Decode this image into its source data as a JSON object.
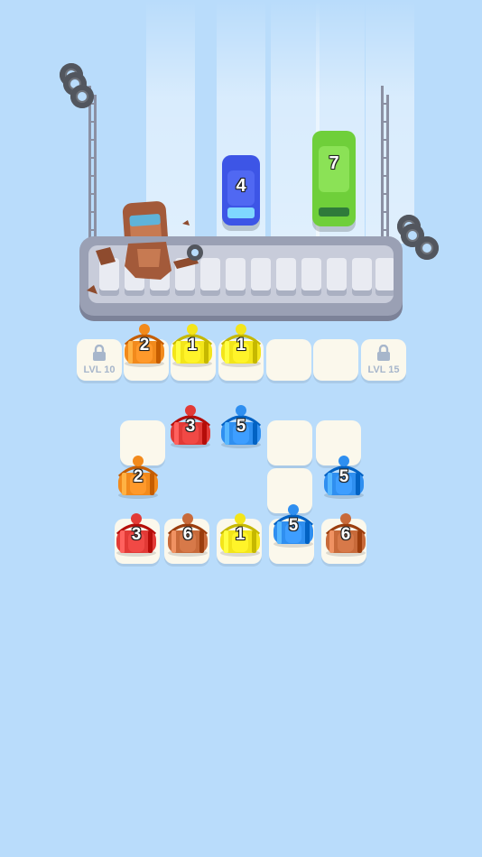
{
  "colors": {
    "background": "#b9dcfb",
    "orange": "#f28a1c",
    "yellow": "#f3e51a",
    "red": "#e23a36",
    "blue": "#2f8ff0",
    "brown": "#c86a3a",
    "car_blue": "#3d55e6",
    "car_green": "#6fcf3a",
    "car_brown": "#a35a3a"
  },
  "cars": [
    {
      "number": "4",
      "color": "blue"
    },
    {
      "number": "7",
      "color": "green"
    },
    {
      "number": "",
      "color": "brown",
      "state": "crushed"
    }
  ],
  "queue": [
    {
      "number": "2",
      "color": "orange"
    },
    {
      "number": "1",
      "color": "yellow"
    },
    {
      "number": "1",
      "color": "yellow"
    }
  ],
  "locked_slots": [
    {
      "label": "LVL 10",
      "icon": "lock-icon"
    },
    {
      "label": "LVL 15",
      "icon": "lock-icon"
    }
  ],
  "grid_people": [
    {
      "number": "3",
      "color": "red"
    },
    {
      "number": "5",
      "color": "blue"
    },
    {
      "number": "2",
      "color": "orange"
    },
    {
      "number": "5",
      "color": "blue"
    },
    {
      "number": "3",
      "color": "red"
    },
    {
      "number": "6",
      "color": "brown"
    },
    {
      "number": "1",
      "color": "yellow"
    },
    {
      "number": "5",
      "color": "blue"
    },
    {
      "number": "6",
      "color": "brown"
    }
  ]
}
